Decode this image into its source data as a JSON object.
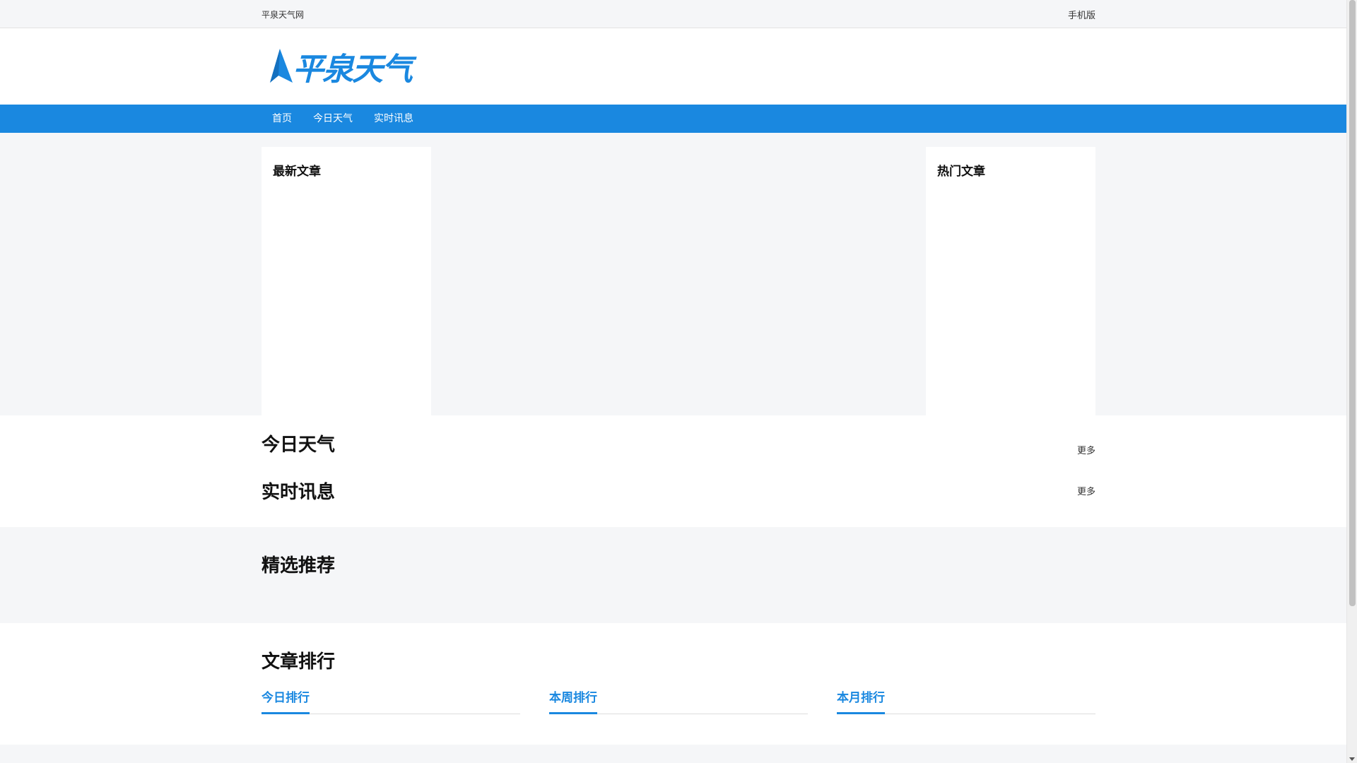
{
  "topbar": {
    "site_name": "平泉天气网",
    "mobile_link": "手机版"
  },
  "header": {
    "logo_text": "平泉天气"
  },
  "nav": {
    "items": [
      "首页",
      "今日天气",
      "实时讯息"
    ]
  },
  "hero": {
    "left_panel_title": "最新文章",
    "right_panel_title": "热门文章"
  },
  "sections": {
    "today_weather": {
      "title": "今日天气",
      "more": "更多"
    },
    "realtime": {
      "title": "实时讯息",
      "more": "更多"
    },
    "featured": {
      "title": "精选推荐"
    },
    "ranking": {
      "title": "文章排行",
      "tabs": [
        "今日排行",
        "本周排行",
        "本月排行"
      ]
    }
  },
  "colors": {
    "accent": "#1a88e0",
    "bg_gray": "#f5f6f8"
  }
}
